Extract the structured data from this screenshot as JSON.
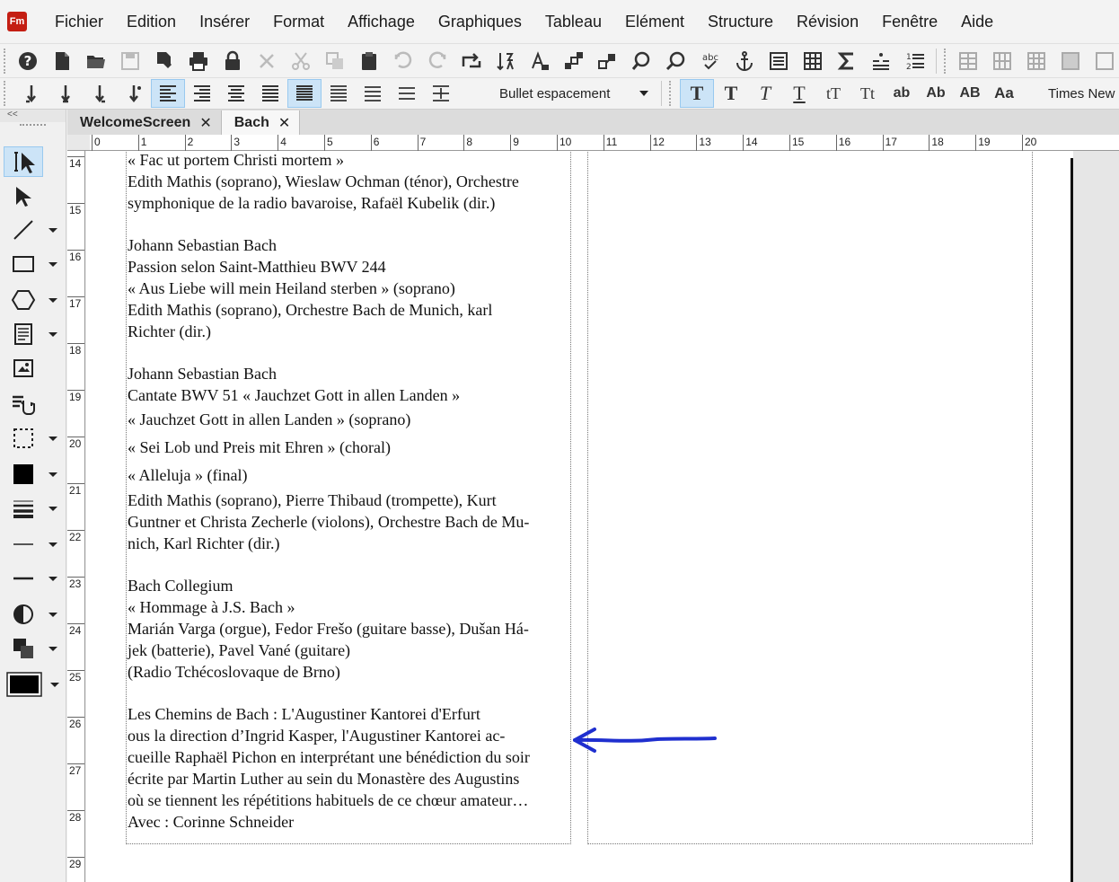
{
  "app": {
    "logo": "Fm"
  },
  "menu": [
    "Fichier",
    "Edition",
    "Insérer",
    "Format",
    "Affichage",
    "Graphiques",
    "Tableau",
    "Elément",
    "Structure",
    "Révision",
    "Fenêtre",
    "Aide"
  ],
  "toolbar": {
    "paragraph_format": "Bullet espacement",
    "font_name": "Times New",
    "char_buttons": [
      "T",
      "T",
      "T",
      "T",
      "tT",
      "Tt",
      "ab",
      "Ab",
      "AB",
      "Aa"
    ]
  },
  "left_panel": {
    "collapse_label": "<<"
  },
  "tabs": [
    {
      "label": "WelcomeScreen",
      "close": "✕"
    },
    {
      "label": "Bach",
      "close": "✕"
    }
  ],
  "ruler": {
    "h": [
      "0",
      "1",
      "2",
      "3",
      "4",
      "5",
      "6",
      "7",
      "8",
      "9",
      "10",
      "11",
      "12",
      "13",
      "14",
      "15",
      "16",
      "17",
      "18",
      "19",
      "20"
    ],
    "v": [
      "14",
      "15",
      "16",
      "17",
      "18",
      "19",
      "20",
      "21",
      "22",
      "23",
      "24",
      "25",
      "26",
      "27",
      "28",
      "29"
    ]
  },
  "document": {
    "lines": [
      "« Fac ut portem Christi mortem »",
      "Edith Mathis (soprano), Wieslaw Ochman (ténor), Orchestre",
      "symphonique de la radio bavaroise, Rafaël Kubelik (dir.)",
      "",
      "Johann Sebastian Bach",
      "Passion selon Saint-Matthieu BWV 244",
      "« Aus Liebe will mein Heiland sterben » (soprano)",
      "Edith Mathis (soprano), Orchestre Bach de Munich, karl",
      "Richter (dir.)",
      "",
      "Johann Sebastian Bach",
      "Cantate BWV 51 « Jauchzet Gott in allen Landen »",
      "« Jauchzet Gott in allen Landen » (soprano)",
      "« Sei Lob und Preis mit Ehren » (choral)",
      "« Alleluja » (final)",
      "Edith Mathis (soprano), Pierre Thibaud (trompette), Kurt",
      "Guntner et Christa Zecherle (violons), Orchestre Bach de Mu-",
      "nich, Karl Richter (dir.)",
      "",
      "Bach Collegium",
      "« Hommage à J.S. Bach »",
      "Marián Varga (orgue), Fedor Frešo (guitare basse), Dušan Há-",
      "jek (batterie), Pavel Vané (guitare)",
      "(Radio Tchécoslovaque de Brno)",
      "",
      "Les Chemins de Bach : L'Augustiner Kantorei d'Erfurt",
      "ous la direction d’Ingrid Kasper, l'Augustiner Kantorei ac-",
      "cueille Raphaël Pichon en interprétant une bénédiction du soir",
      "écrite par Martin Luther au sein du Monastère des Augustins",
      "où se tiennent les répétitions habituels de ce chœur amateur…",
      "Avec : Corinne Schneider"
    ]
  },
  "colors": {
    "annotation_arrow": "#1f2fcf",
    "logo_bg": "#c41e13",
    "active_tool": "#cce4f7"
  }
}
